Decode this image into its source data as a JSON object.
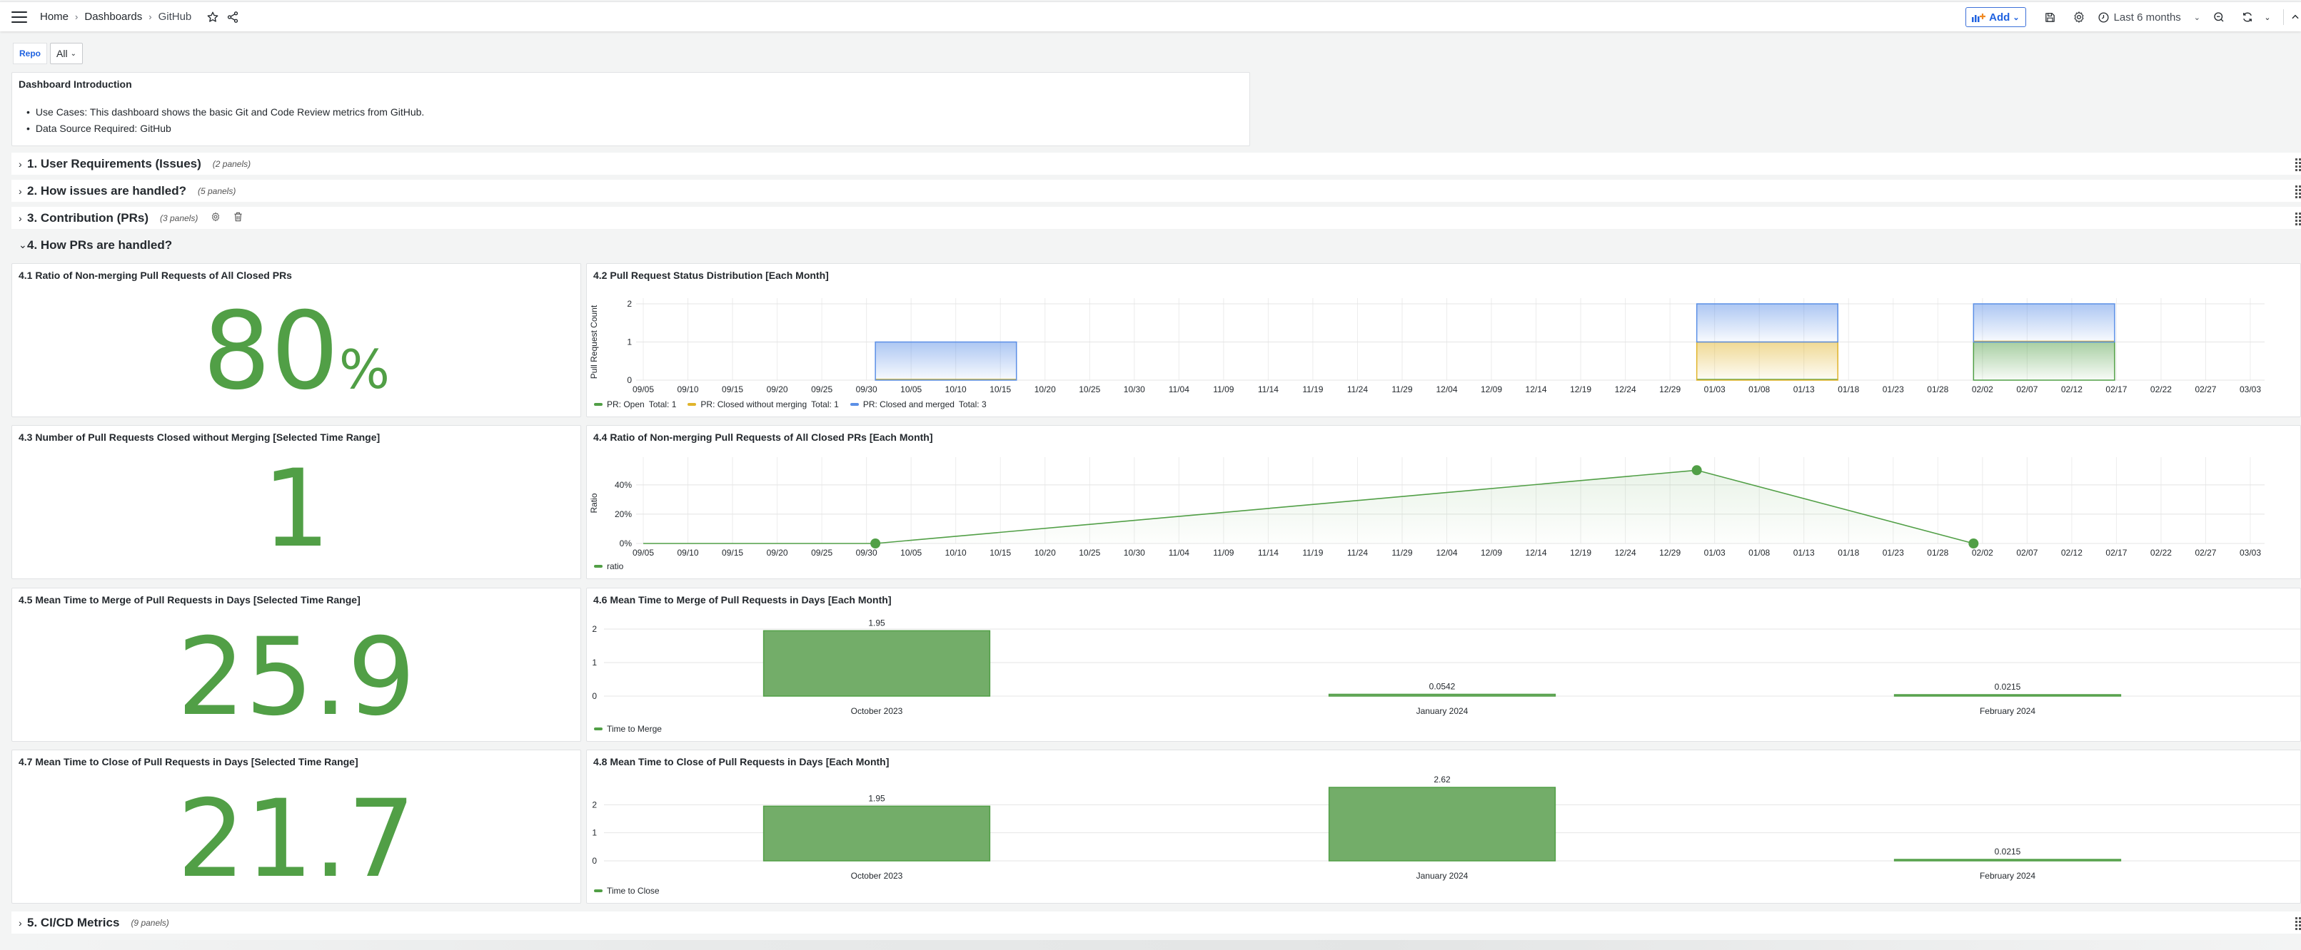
{
  "topbar": {
    "breadcrumbs": [
      "Home",
      "Dashboards",
      "GitHub"
    ],
    "add_label": "Add",
    "time_range": "Last 6 months",
    "icons": [
      "menu-icon",
      "star-icon",
      "share-icon",
      "add-panel-icon",
      "save-icon",
      "settings-icon",
      "clock-icon",
      "zoom-out-icon",
      "refresh-icon",
      "chevron-up-icon"
    ]
  },
  "variables": {
    "repo_label": "Repo",
    "repo_value": "All"
  },
  "intro": {
    "title": "Dashboard Introduction",
    "items": [
      "Use Cases: This dashboard shows the basic Git and Code Review metrics from GitHub.",
      "Data Source Required: GitHub"
    ]
  },
  "rows": [
    {
      "title": "1. User Requirements (Issues)",
      "count": "(2 panels)",
      "collapsed": true
    },
    {
      "title": "2. How issues are handled?",
      "count": "(5 panels)",
      "collapsed": true
    },
    {
      "title": "3. Contribution (PRs)",
      "count": "(3 panels)",
      "collapsed": true
    },
    {
      "title": "4. How PRs are handled?",
      "count": "",
      "collapsed": false
    },
    {
      "title": "5. CI/CD Metrics",
      "count": "(9 panels)",
      "collapsed": true
    }
  ],
  "colors": {
    "green": "#519f46",
    "yellow": "#e0b42b",
    "blue": "#5b8fe6",
    "bar_fill": "#73ad69"
  },
  "stats": {
    "p41": {
      "title": "4.1 Ratio of Non-merging Pull Requests of All Closed PRs",
      "value": "80",
      "unit": "%"
    },
    "p43": {
      "title": "4.3 Number of Pull Requests Closed without Merging [Selected Time Range]",
      "value": "1"
    },
    "p45": {
      "title": "4.5 Mean Time to Merge of Pull Requests in Days [Selected Time Range]",
      "value": "25.9"
    },
    "p47": {
      "title": "4.7 Mean Time to Close of Pull Requests in Days [Selected Time Range]",
      "value": "21.7"
    }
  },
  "date_ticks": [
    "09/05",
    "09/10",
    "09/15",
    "09/20",
    "09/25",
    "09/30",
    "10/05",
    "10/10",
    "10/15",
    "10/20",
    "10/25",
    "10/30",
    "11/04",
    "11/09",
    "11/14",
    "11/19",
    "11/24",
    "11/29",
    "12/04",
    "12/09",
    "12/14",
    "12/19",
    "12/24",
    "12/29",
    "01/03",
    "01/08",
    "01/13",
    "01/18",
    "01/23",
    "01/28",
    "02/02",
    "02/07",
    "02/12",
    "02/17",
    "02/22",
    "02/27",
    "03/03"
  ],
  "chart_data": [
    {
      "id": "p42",
      "type": "bar",
      "title": "4.2 Pull Request Status Distribution [Each Month]",
      "ylabel": "Pull Request Count",
      "ylim": [
        0,
        2
      ],
      "yticks": [
        0,
        1,
        2
      ],
      "stacked": true,
      "categories": [
        "October 2023",
        "January 2024",
        "February 2024"
      ],
      "bar_start_day": [
        26,
        118,
        149
      ],
      "bar_span_days": 15,
      "series": [
        {
          "name": "PR: Open",
          "total": "Total: 1",
          "color": "#519f46",
          "values": [
            0,
            0,
            1
          ]
        },
        {
          "name": "PR: Closed without merging",
          "total": "Total: 1",
          "color": "#e0b42b",
          "values": [
            0,
            1,
            0
          ]
        },
        {
          "name": "PR: Closed and merged",
          "total": "Total: 3",
          "color": "#5b8fe6",
          "values": [
            1,
            1,
            1
          ]
        }
      ]
    },
    {
      "id": "p44",
      "type": "line",
      "title": "4.4 Ratio of Non-merging Pull Requests of All Closed PRs [Each Month]",
      "ylabel": "Ratio",
      "ylim": [
        0,
        0.55
      ],
      "yticks": [
        0,
        0.2,
        0.4
      ],
      "ytick_labels": [
        "0%",
        "20%",
        "40%"
      ],
      "series": [
        {
          "name": "ratio",
          "color": "#519f46",
          "points": [
            {
              "day": 0,
              "value": 0,
              "marker": false
            },
            {
              "day": 26,
              "value": 0,
              "marker": true
            },
            {
              "day": 118,
              "value": 0.5,
              "marker": true
            },
            {
              "day": 149,
              "value": 0,
              "marker": true
            }
          ]
        }
      ]
    },
    {
      "id": "p46",
      "type": "bar",
      "title": "4.6 Mean Time to Merge of Pull Requests in Days [Each Month]",
      "ylim": [
        0,
        2
      ],
      "yticks": [
        0,
        1,
        2
      ],
      "categories": [
        "October 2023",
        "January 2024",
        "February 2024"
      ],
      "series": [
        {
          "name": "Time to Merge",
          "color": "#519f46",
          "values": [
            1.95,
            0.0542,
            0.0215
          ],
          "labels": [
            "1.95",
            "0.0542",
            "0.0215"
          ]
        }
      ]
    },
    {
      "id": "p48",
      "type": "bar",
      "title": "4.8 Mean Time to Close of Pull Requests in Days [Each Month]",
      "ylim": [
        0,
        2.62
      ],
      "yticks": [
        0,
        1,
        2
      ],
      "categories": [
        "October 2023",
        "January 2024",
        "February 2024"
      ],
      "series": [
        {
          "name": "Time to Close",
          "color": "#519f46",
          "values": [
            1.95,
            2.62,
            0.0215
          ],
          "labels": [
            "1.95",
            "2.62",
            "0.0215"
          ]
        }
      ]
    }
  ]
}
